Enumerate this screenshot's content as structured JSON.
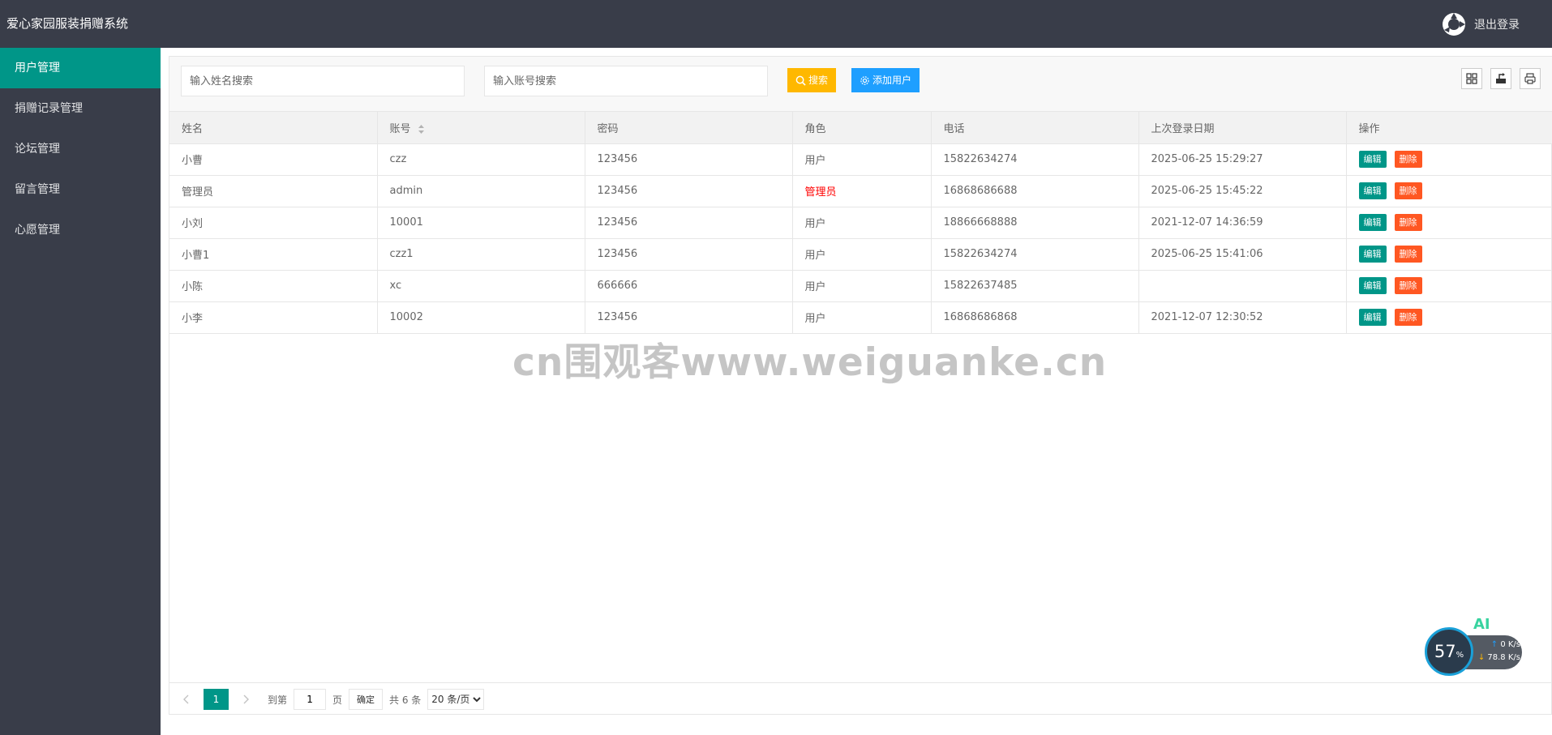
{
  "header": {
    "app_title": "爱心家园服装捐赠系统",
    "logout_label": "退出登录"
  },
  "sidebar": {
    "items": [
      {
        "label": "用户管理",
        "active": true
      },
      {
        "label": "捐赠记录管理",
        "active": false
      },
      {
        "label": "论坛管理",
        "active": false
      },
      {
        "label": "留言管理",
        "active": false
      },
      {
        "label": "心愿管理",
        "active": false
      }
    ]
  },
  "toolbar": {
    "name_search_placeholder": "输入姓名搜索",
    "account_search_placeholder": "输入账号搜索",
    "search_label": "搜索",
    "add_user_label": "添加用户"
  },
  "table": {
    "headers": [
      "姓名",
      "账号",
      "密码",
      "角色",
      "电话",
      "上次登录日期",
      "操作"
    ],
    "rows": [
      {
        "name": "小曹",
        "account": "czz",
        "password": "123456",
        "role": "用户",
        "phone": "15822634274",
        "last_login": "2025-06-25 15:29:27"
      },
      {
        "name": "管理员",
        "account": "admin",
        "password": "123456",
        "role": "管理员",
        "phone": "16868686688",
        "last_login": "2025-06-25 15:45:22"
      },
      {
        "name": "小刘",
        "account": "10001",
        "password": "123456",
        "role": "用户",
        "phone": "18866668888",
        "last_login": "2021-12-07 14:36:59"
      },
      {
        "name": "小曹1",
        "account": "czz1",
        "password": "123456",
        "role": "用户",
        "phone": "15822634274",
        "last_login": "2025-06-25 15:41:06"
      },
      {
        "name": "小陈",
        "account": "xc",
        "password": "666666",
        "role": "用户",
        "phone": "15822637485",
        "last_login": ""
      },
      {
        "name": "小李",
        "account": "10002",
        "password": "123456",
        "role": "用户",
        "phone": "16868686868",
        "last_login": "2021-12-07 12:30:52"
      }
    ],
    "edit_label": "编辑",
    "delete_label": "删除"
  },
  "pager": {
    "current_page": "1",
    "goto_prefix": "到第",
    "goto_value": "1",
    "goto_suffix": "页",
    "confirm_label": "确定",
    "total_label": "共 6 条",
    "page_size_label": "20 条/页"
  },
  "watermark": "cn围观客www.weiguanke.cn",
  "widget": {
    "ai_label": "AI",
    "percent": "57",
    "percent_unit": "%",
    "upload_speed": "0 K/s",
    "download_speed": "78.8 K/s"
  },
  "colors": {
    "header_bg": "#393d49",
    "active_nav": "#009688",
    "search_btn": "#ffb800",
    "add_btn": "#1e9fff",
    "edit_btn": "#009688",
    "delete_btn": "#ff5722",
    "admin_role": "#ff0000"
  }
}
